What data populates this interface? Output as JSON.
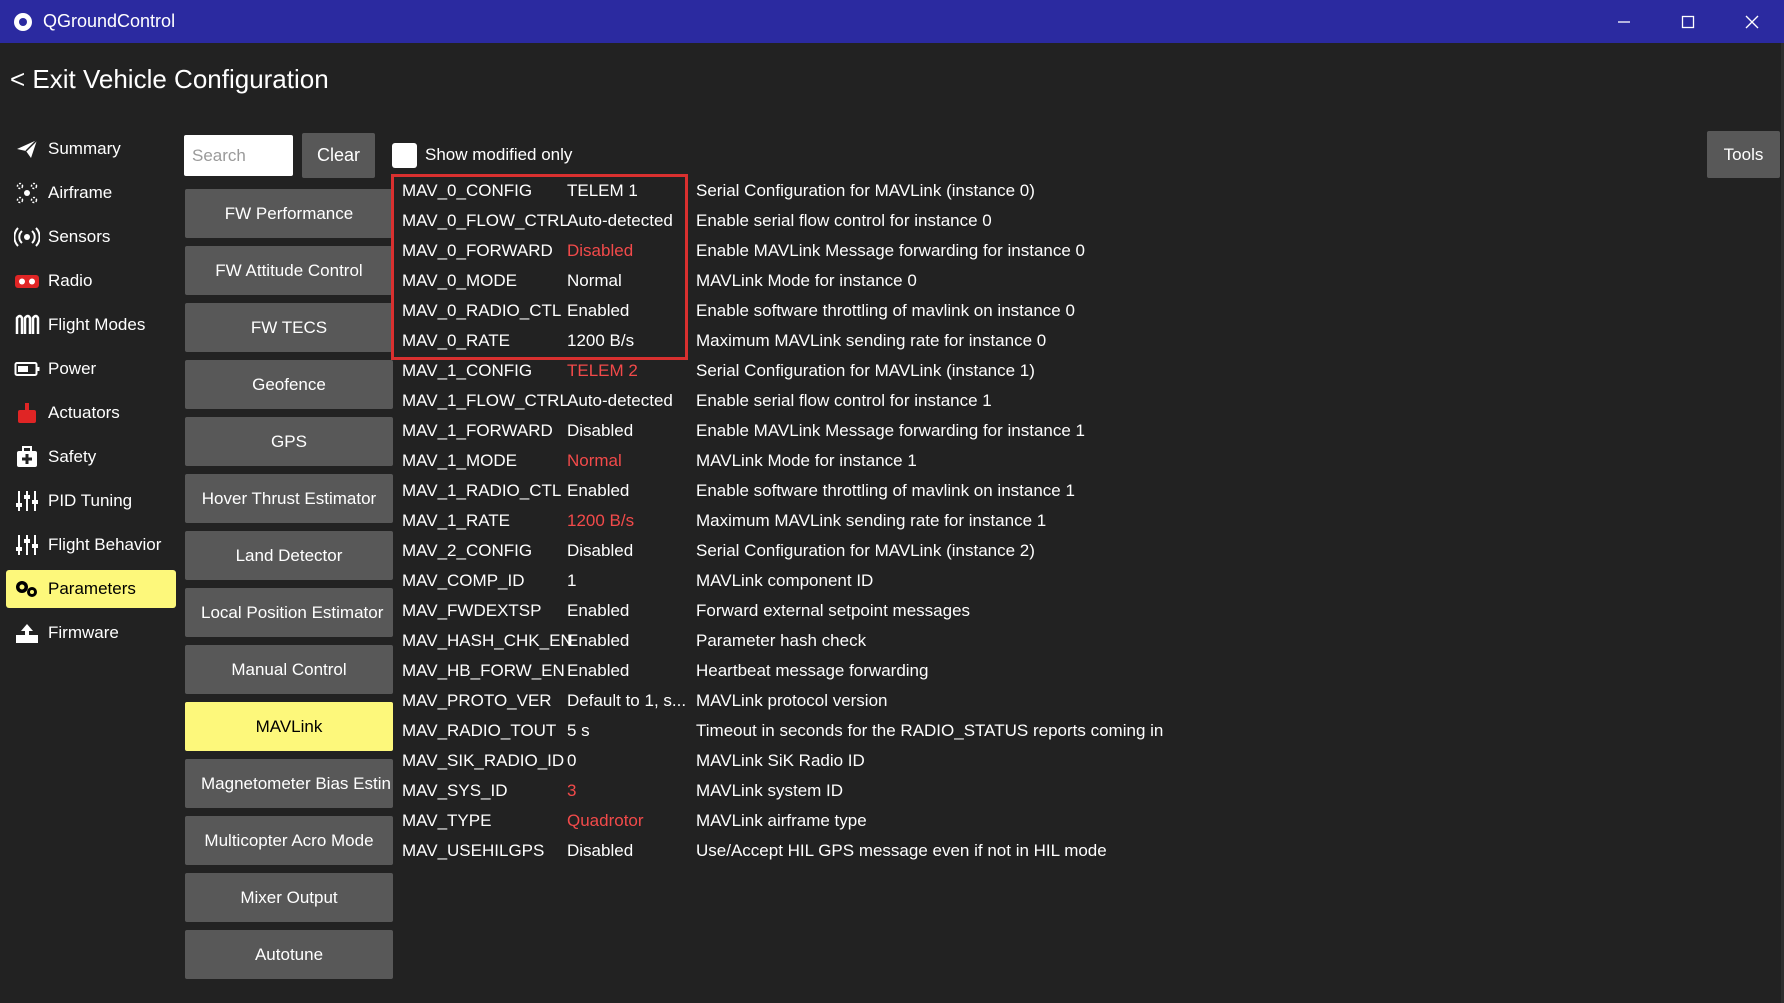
{
  "window": {
    "title": "QGroundControl",
    "controls": [
      "minimize-icon",
      "maximize-icon",
      "close-icon"
    ]
  },
  "header": {
    "exit_label": "< Exit Vehicle Configuration"
  },
  "sidebar": {
    "items": [
      {
        "label": "Summary",
        "icon": "paper-plane-icon"
      },
      {
        "label": "Airframe",
        "icon": "airframe-icon"
      },
      {
        "label": "Sensors",
        "icon": "sensor-waves-icon"
      },
      {
        "label": "Radio",
        "icon": "radio-icon"
      },
      {
        "label": "Flight Modes",
        "icon": "flight-modes-icon"
      },
      {
        "label": "Power",
        "icon": "battery-icon"
      },
      {
        "label": "Actuators",
        "icon": "actuator-icon"
      },
      {
        "label": "Safety",
        "icon": "safety-kit-icon"
      },
      {
        "label": "PID Tuning",
        "icon": "sliders-icon"
      },
      {
        "label": "Flight Behavior",
        "icon": "sliders-icon"
      },
      {
        "label": "Parameters",
        "icon": "gears-icon",
        "active": true
      },
      {
        "label": "Firmware",
        "icon": "firmware-upload-icon"
      }
    ]
  },
  "toolbar": {
    "search_placeholder": "Search",
    "search_value": "",
    "clear_label": "Clear",
    "show_modified_label": "Show modified only",
    "show_modified_checked": false,
    "tools_label": "Tools"
  },
  "groups": [
    {
      "label": "FW Performance"
    },
    {
      "label": "FW Attitude Control"
    },
    {
      "label": "FW TECS"
    },
    {
      "label": "Geofence"
    },
    {
      "label": "GPS"
    },
    {
      "label": "Hover Thrust Estimator"
    },
    {
      "label": "Land Detector"
    },
    {
      "label": "Local Position Estimator"
    },
    {
      "label": "Manual Control"
    },
    {
      "label": "MAVLink",
      "active": true
    },
    {
      "label": "Magnetometer Bias Estin"
    },
    {
      "label": "Multicopter Acro Mode"
    },
    {
      "label": "Mixer Output"
    },
    {
      "label": "Autotune"
    }
  ],
  "params": [
    {
      "name": "MAV_0_CONFIG",
      "value": "TELEM 1",
      "modified": false,
      "desc": "Serial Configuration for MAVLink (instance 0)"
    },
    {
      "name": "MAV_0_FLOW_CTRL",
      "value": "Auto-detected",
      "modified": false,
      "desc": "Enable serial flow control for instance 0"
    },
    {
      "name": "MAV_0_FORWARD",
      "value": "Disabled",
      "modified": true,
      "desc": "Enable MAVLink Message forwarding for instance 0"
    },
    {
      "name": "MAV_0_MODE",
      "value": "Normal",
      "modified": false,
      "desc": "MAVLink Mode for instance 0"
    },
    {
      "name": "MAV_0_RADIO_CTL",
      "value": "Enabled",
      "modified": false,
      "desc": "Enable software throttling of mavlink on instance 0"
    },
    {
      "name": "MAV_0_RATE",
      "value": "1200 B/s",
      "modified": false,
      "desc": "Maximum MAVLink sending rate for instance 0"
    },
    {
      "name": "MAV_1_CONFIG",
      "value": "TELEM 2",
      "modified": true,
      "desc": "Serial Configuration for MAVLink (instance 1)"
    },
    {
      "name": "MAV_1_FLOW_CTRL",
      "value": "Auto-detected",
      "modified": false,
      "desc": "Enable serial flow control for instance 1"
    },
    {
      "name": "MAV_1_FORWARD",
      "value": "Disabled",
      "modified": false,
      "desc": "Enable MAVLink Message forwarding for instance 1"
    },
    {
      "name": "MAV_1_MODE",
      "value": "Normal",
      "modified": true,
      "desc": "MAVLink Mode for instance 1"
    },
    {
      "name": "MAV_1_RADIO_CTL",
      "value": "Enabled",
      "modified": false,
      "desc": "Enable software throttling of mavlink on instance 1"
    },
    {
      "name": "MAV_1_RATE",
      "value": "1200 B/s",
      "modified": true,
      "desc": "Maximum MAVLink sending rate for instance 1"
    },
    {
      "name": "MAV_2_CONFIG",
      "value": "Disabled",
      "modified": false,
      "desc": "Serial Configuration for MAVLink (instance 2)"
    },
    {
      "name": "MAV_COMP_ID",
      "value": "1",
      "modified": false,
      "desc": "MAVLink component ID"
    },
    {
      "name": "MAV_FWDEXTSP",
      "value": "Enabled",
      "modified": false,
      "desc": "Forward external setpoint messages"
    },
    {
      "name": "MAV_HASH_CHK_EN",
      "value": "Enabled",
      "modified": false,
      "desc": "Parameter hash check"
    },
    {
      "name": "MAV_HB_FORW_EN",
      "value": "Enabled",
      "modified": false,
      "desc": "Heartbeat message forwarding"
    },
    {
      "name": "MAV_PROTO_VER",
      "value": "Default to 1, s...",
      "modified": false,
      "desc": "MAVLink protocol version"
    },
    {
      "name": "MAV_RADIO_TOUT",
      "value": "5 s",
      "modified": false,
      "desc": "Timeout in seconds for the RADIO_STATUS reports coming in"
    },
    {
      "name": "MAV_SIK_RADIO_ID",
      "value": "0",
      "modified": false,
      "desc": "MAVLink SiK Radio ID"
    },
    {
      "name": "MAV_SYS_ID",
      "value": "3",
      "modified": true,
      "desc": "MAVLink system ID"
    },
    {
      "name": "MAV_TYPE",
      "value": "Quadrotor",
      "modified": true,
      "desc": "MAVLink airframe type"
    },
    {
      "name": "MAV_USEHILGPS",
      "value": "Disabled",
      "modified": false,
      "desc": "Use/Accept HIL GPS message even if not in HIL mode"
    }
  ],
  "colors": {
    "titlebar": "#2b2aa0",
    "background": "#222222",
    "button": "#585858",
    "active": "#fdf87b",
    "modified_value": "#f24a4a",
    "highlight_box": "#d9302f"
  }
}
